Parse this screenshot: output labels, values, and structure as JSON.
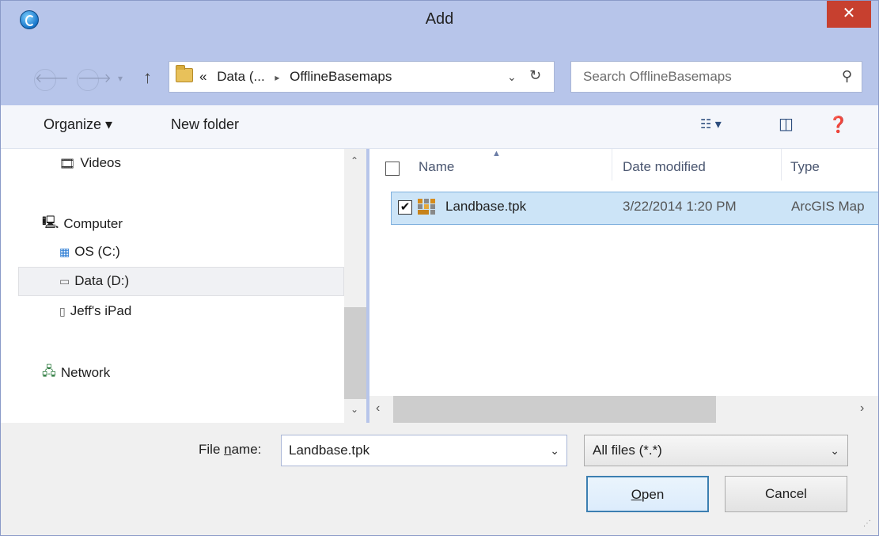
{
  "window": {
    "title": "Add",
    "close_label": "✕"
  },
  "address_bar": {
    "overflow": "«",
    "crumbs": [
      "Data (...",
      "OfflineBasemaps"
    ],
    "separator": "▸"
  },
  "search": {
    "placeholder": "Search OfflineBasemaps"
  },
  "toolbar": {
    "organize_label": "Organize ▾",
    "new_folder_label": "New folder"
  },
  "nav_pane": {
    "items": [
      {
        "label": "Videos",
        "icon": "film-icon"
      },
      {
        "label": "Computer",
        "icon": "computer-icon"
      },
      {
        "label": "OS (C:)",
        "icon": "windows-drive-icon"
      },
      {
        "label": "Data (D:)",
        "icon": "drive-icon",
        "selected": true
      },
      {
        "label": "Jeff's iPad",
        "icon": "ipad-icon"
      },
      {
        "label": "Network",
        "icon": "network-icon"
      }
    ]
  },
  "file_list": {
    "columns": [
      "Name",
      "Date modified",
      "Type"
    ],
    "rows": [
      {
        "name": "Landbase.tpk",
        "date_modified": "3/22/2014 1:20 PM",
        "type": "ArcGIS Map",
        "checked": true,
        "selected": true
      }
    ]
  },
  "footer": {
    "file_name_label_pre": "File ",
    "file_name_label_u": "n",
    "file_name_label_post": "ame:",
    "file_name_value": "Landbase.tpk",
    "filter_value": "All files (*.*)",
    "open_u": "O",
    "open_rest": "pen",
    "cancel_label": "Cancel"
  },
  "colors": {
    "frame": "#b7c5ea",
    "close": "#c7402f",
    "selection": "#cce4f7"
  }
}
